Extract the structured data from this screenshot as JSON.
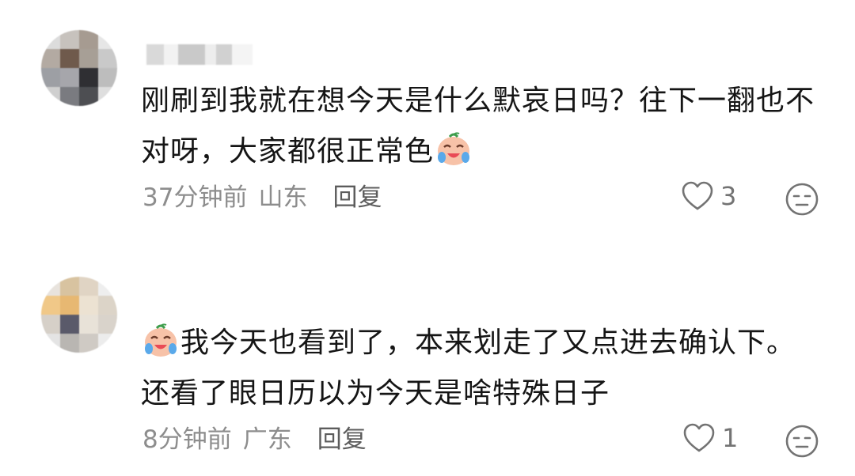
{
  "comments": [
    {
      "text_parts": [
        "刚刷到我就在想今天是什么默哀日吗？往下一翻也不对呀，大家都很正常色"
      ],
      "time": "37分钟前",
      "location": "山东",
      "reply_label": "回复",
      "like_count": "3",
      "emoji": "crying-laughing-face-icon"
    },
    {
      "text_parts": [
        "我今天也看到了，本来划走了又点进去确认下。还看了眼日历以为今天是啥特殊日子"
      ],
      "time": "8分钟前",
      "location": "广东",
      "reply_label": "回复",
      "like_count": "1",
      "emoji": "crying-laughing-face-icon"
    }
  ],
  "colors": {
    "text": "#151515",
    "meta": "#8d8d8d",
    "reply": "#5c5c5c",
    "icon": "#737373"
  }
}
